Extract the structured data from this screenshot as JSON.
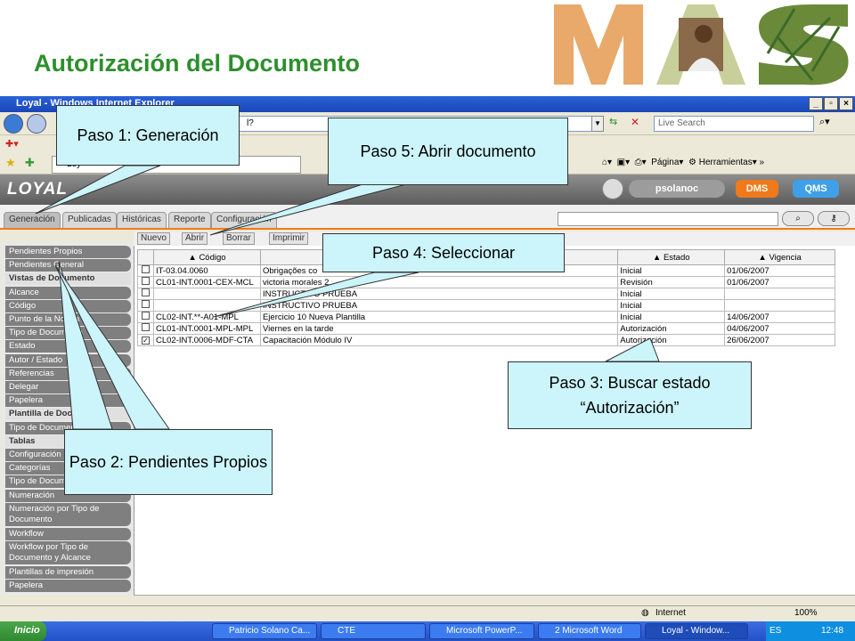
{
  "slide": {
    "title": "Autorización del Documento"
  },
  "browser": {
    "window_title": "Loyal - Windows Internet Explorer",
    "url_fragment": "l?",
    "live_search_placeholder": "Live Search",
    "tab_title": "Loy",
    "tools": {
      "page": "Página",
      "tools": "Herramientas"
    },
    "status_zone": "Internet",
    "zoom": "100%"
  },
  "app": {
    "logo": "LOYAL",
    "user": "psolanoc",
    "dms": "DMS",
    "qms": "QMS",
    "tabs": [
      "Generación",
      "Publicadas",
      "Históricas",
      "Reporte",
      "Configuración"
    ],
    "toolbar": [
      "Nuevo",
      "Abrir",
      "Borrar",
      "Imprimir"
    ],
    "sidebar": [
      {
        "label": "Pendientes Propios",
        "type": "item"
      },
      {
        "label": "Pendientes General",
        "type": "item"
      },
      {
        "label": "Vistas de Documento",
        "type": "head"
      },
      {
        "label": "Alcance",
        "type": "item"
      },
      {
        "label": "Código",
        "type": "item"
      },
      {
        "label": "Punto de la Norma",
        "type": "item"
      },
      {
        "label": "Tipo de Documento",
        "type": "item"
      },
      {
        "label": "Estado",
        "type": "item"
      },
      {
        "label": "Autor / Estado",
        "type": "item"
      },
      {
        "label": "Referencias",
        "type": "item"
      },
      {
        "label": "Delegar",
        "type": "item"
      },
      {
        "label": "Papelera",
        "type": "item"
      },
      {
        "label": "Plantilla de Documento",
        "type": "head"
      },
      {
        "label": "Tipo de Documento",
        "type": "item"
      },
      {
        "label": "Tablas",
        "type": "head"
      },
      {
        "label": "Configuración",
        "type": "item"
      },
      {
        "label": "Categorías",
        "type": "item"
      },
      {
        "label": "Tipo de Documento",
        "type": "item"
      },
      {
        "label": "Numeración",
        "type": "item"
      },
      {
        "label": "Numeración por Tipo de Documento",
        "type": "item2"
      },
      {
        "label": "Workflow",
        "type": "item"
      },
      {
        "label": "Workflow por Tipo de Documento y Alcance",
        "type": "item2"
      },
      {
        "label": "Plantillas de impresión",
        "type": "item"
      },
      {
        "label": "Papelera",
        "type": "item"
      }
    ],
    "columns": [
      "Código",
      "",
      "Estado",
      "Vigencia"
    ],
    "rows": [
      {
        "checked": false,
        "codigo": "IT-03.04.0060",
        "titulo": "Obrigações co",
        "estado": "Inicial",
        "vigencia": "01/06/2007"
      },
      {
        "checked": false,
        "codigo": "CL01-INT.0001-CEX-MCL",
        "titulo": "victoria morales 2",
        "estado": "Revisión",
        "vigencia": "01/06/2007"
      },
      {
        "checked": false,
        "codigo": "",
        "titulo": "INSTRUCTIVO PRUEBA",
        "estado": "Inicial",
        "vigencia": ""
      },
      {
        "checked": false,
        "codigo": "",
        "titulo": "INSTRUCTIVO PRUEBA",
        "estado": "Inicial",
        "vigencia": ""
      },
      {
        "checked": false,
        "codigo": "CL02-INT.**-A01-MPL",
        "titulo": "Ejercicio 10 Nueva Plantilla",
        "estado": "Inicial",
        "vigencia": "14/06/2007"
      },
      {
        "checked": false,
        "codigo": "CL01-INT.0001-MPL-MPL",
        "titulo": "Viernes en la tarde",
        "estado": "Autorización",
        "vigencia": "04/06/2007"
      },
      {
        "checked": true,
        "codigo": "CL02-INT.0006-MDF-CTA",
        "titulo": "Capacitación Módulo IV",
        "estado": "Autorización",
        "vigencia": "26/06/2007"
      }
    ]
  },
  "callouts": {
    "paso1": "Paso 1: Generación",
    "paso2": "Paso 2: Pendientes Propios",
    "paso3": "Paso 3: Buscar estado “Autorización”",
    "paso4": "Paso 4: Seleccionar",
    "paso5": "Paso 5: Abrir documento"
  },
  "taskbar": {
    "start": "Inicio",
    "tasks": [
      "Patricio Solano Ca...",
      "CTE",
      "Microsoft PowerP...",
      "2 Microsoft Word",
      "Loyal - Window..."
    ],
    "lang": "ES",
    "clock": "12:48"
  },
  "colors": {
    "title": "#2d8f2d",
    "accent": "#f07a1a",
    "callout_bg": "#ccf5fb"
  }
}
